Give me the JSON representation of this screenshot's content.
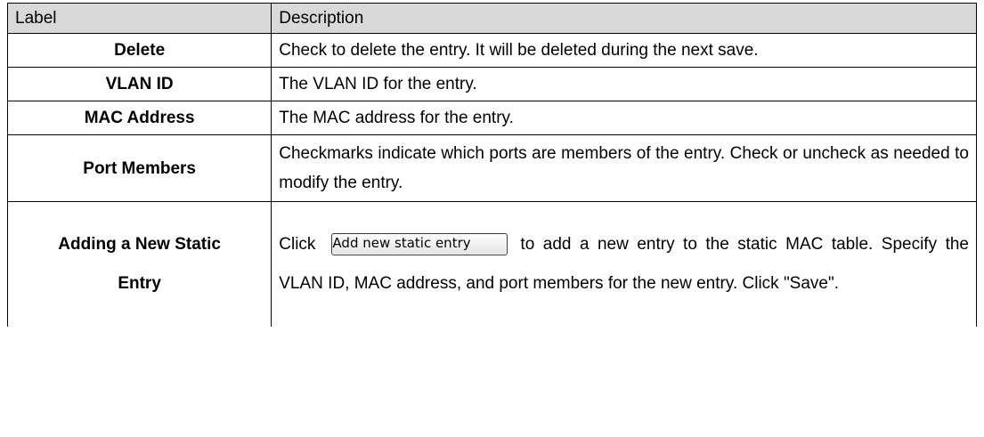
{
  "table": {
    "header": {
      "label": "Label",
      "description": "Description"
    },
    "rows": [
      {
        "label": "Delete",
        "description": "Check to delete the entry. It will be deleted during the next save."
      },
      {
        "label": "VLAN ID",
        "description": "The VLAN ID for the entry."
      },
      {
        "label": "MAC Address",
        "description": "The MAC address for the entry."
      },
      {
        "label": "Port Members",
        "description": "Checkmarks indicate which ports are members of the entry. Check or uncheck as needed to modify the entry."
      },
      {
        "label_line1": "Adding a New Static",
        "label_line2": "Entry",
        "description_prefix": "Click",
        "button_label": "Add new static entry",
        "description_suffix": "to add a new entry to the static MAC table. Specify the VLAN ID, MAC address, and port members for the new entry. Click \"Save\"."
      }
    ]
  },
  "colors": {
    "header_background": "#d9d9d9",
    "border": "#000000",
    "text": "#000000"
  }
}
